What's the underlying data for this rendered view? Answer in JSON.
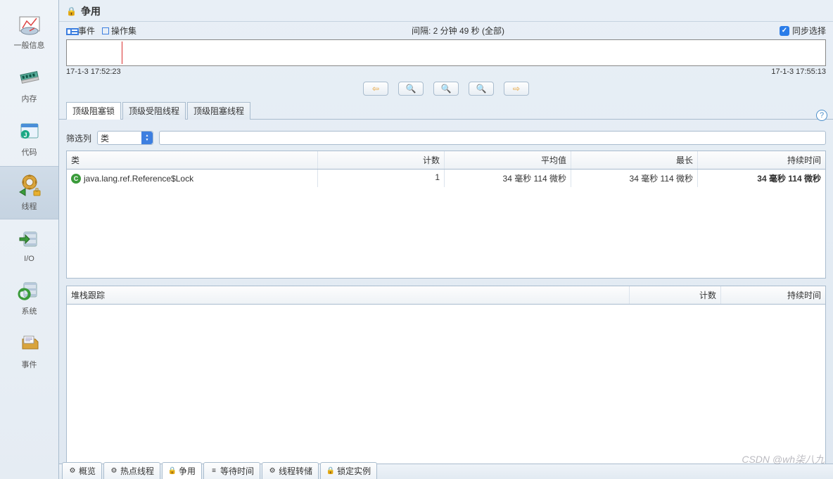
{
  "sidebar": {
    "items": [
      {
        "label": "一般信息"
      },
      {
        "label": "内存"
      },
      {
        "label": "代码"
      },
      {
        "label": "线程"
      },
      {
        "label": "I/O"
      },
      {
        "label": "系统"
      },
      {
        "label": "事件"
      }
    ],
    "selected_index": 3
  },
  "header": {
    "title": "争用"
  },
  "toolbar": {
    "events_label": "事件",
    "opsets_label": "操作集"
  },
  "interval": {
    "text": "间隔: 2 分钟 49 秒 (全部)",
    "sync_label": "同步选择",
    "sync_checked": true
  },
  "timeline": {
    "start": "17-1-3 17:52:23",
    "end": "17-1-3 17:55:13"
  },
  "subtabs": [
    {
      "label": "顶级阻塞锁",
      "active": true
    },
    {
      "label": "顶级受阻线程",
      "active": false
    },
    {
      "label": "顶级阻塞线程",
      "active": false
    }
  ],
  "filter": {
    "label": "筛选列",
    "selected": "类"
  },
  "table": {
    "columns": {
      "class": "类",
      "count": "计数",
      "avg": "平均值",
      "max": "最长",
      "duration": "持续时间"
    },
    "rows": [
      {
        "class": "java.lang.ref.Reference$Lock",
        "count": "1",
        "avg": "34 毫秒 114 微秒",
        "max": "34 毫秒 114 微秒",
        "duration": "34 毫秒 114 微秒"
      }
    ]
  },
  "stack": {
    "columns": {
      "trace": "堆栈跟踪",
      "count": "计数",
      "duration": "持续时间"
    }
  },
  "bottom_tabs": [
    {
      "label": "概览"
    },
    {
      "label": "热点线程"
    },
    {
      "label": "争用"
    },
    {
      "label": "等待时间"
    },
    {
      "label": "线程转储"
    },
    {
      "label": "锁定实例"
    }
  ],
  "watermark": "CSDN @wh柒八九"
}
